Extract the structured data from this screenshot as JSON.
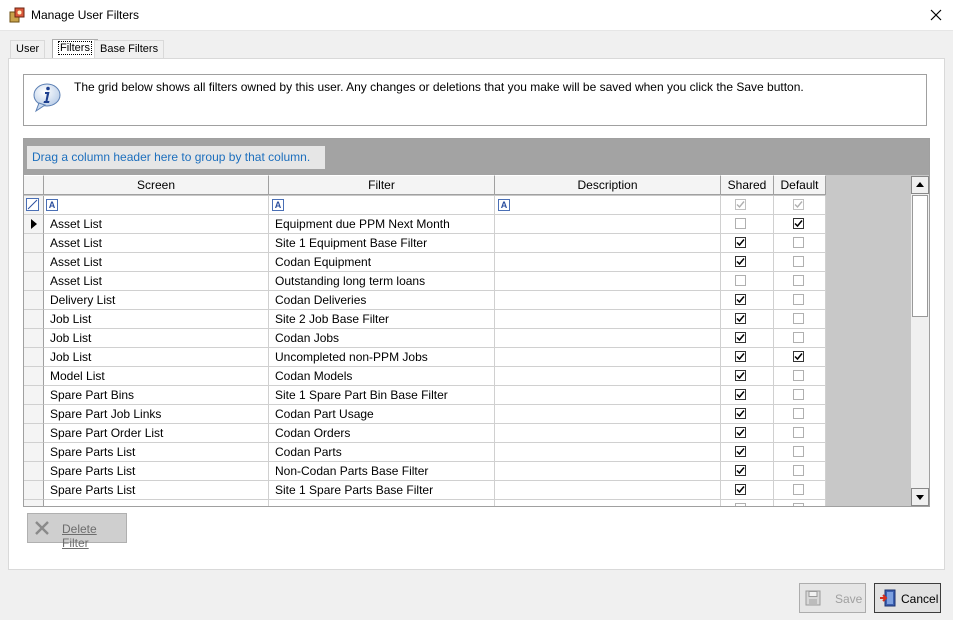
{
  "window": {
    "title": "Manage User Filters"
  },
  "tabs": [
    {
      "label": "User"
    },
    {
      "label": "Filters"
    },
    {
      "label": "Base Filters"
    }
  ],
  "info": {
    "text": "The grid below shows all filters owned by this user. Any changes or deletions that you make will be saved when you click the Save button."
  },
  "grid": {
    "group_hint": "Drag a column header here to group by that column.",
    "columns": [
      "Screen",
      "Filter",
      "Description",
      "Shared",
      "Default"
    ],
    "rows": [
      {
        "screen": "Asset List",
        "filter": "Equipment due PPM Next Month",
        "description": "",
        "shared": false,
        "default": true,
        "current": true
      },
      {
        "screen": "Asset List",
        "filter": "Site 1 Equipment Base Filter",
        "description": "",
        "shared": true,
        "default": false
      },
      {
        "screen": "Asset List",
        "filter": "Codan Equipment",
        "description": "",
        "shared": true,
        "default": false
      },
      {
        "screen": "Asset List",
        "filter": "Outstanding long term loans",
        "description": "",
        "shared": false,
        "default": false
      },
      {
        "screen": "Delivery List",
        "filter": "Codan Deliveries",
        "description": "",
        "shared": true,
        "default": false
      },
      {
        "screen": "Job List",
        "filter": "Site 2 Job Base Filter",
        "description": "",
        "shared": true,
        "default": false
      },
      {
        "screen": "Job List",
        "filter": "Codan Jobs",
        "description": "",
        "shared": true,
        "default": false
      },
      {
        "screen": "Job List",
        "filter": "Uncompleted non-PPM Jobs",
        "description": "",
        "shared": true,
        "default": true
      },
      {
        "screen": "Model List",
        "filter": "Codan Models",
        "description": "",
        "shared": true,
        "default": false
      },
      {
        "screen": "Spare Part Bins",
        "filter": "Site 1 Spare Part Bin Base Filter",
        "description": "",
        "shared": true,
        "default": false
      },
      {
        "screen": "Spare Part Job Links",
        "filter": "Codan Part Usage",
        "description": "",
        "shared": true,
        "default": false
      },
      {
        "screen": "Spare Part Order List",
        "filter": "Codan Orders",
        "description": "",
        "shared": true,
        "default": false
      },
      {
        "screen": "Spare Parts List",
        "filter": "Codan Parts",
        "description": "",
        "shared": true,
        "default": false
      },
      {
        "screen": "Spare Parts List",
        "filter": "Non-Codan Parts Base Filter",
        "description": "",
        "shared": true,
        "default": false
      },
      {
        "screen": "Spare Parts List",
        "filter": "Site 1 Spare Parts Base Filter",
        "description": "",
        "shared": true,
        "default": false
      }
    ]
  },
  "buttons": {
    "delete_filter": "Delete Filter",
    "save": "Save",
    "cancel": "Cancel"
  }
}
